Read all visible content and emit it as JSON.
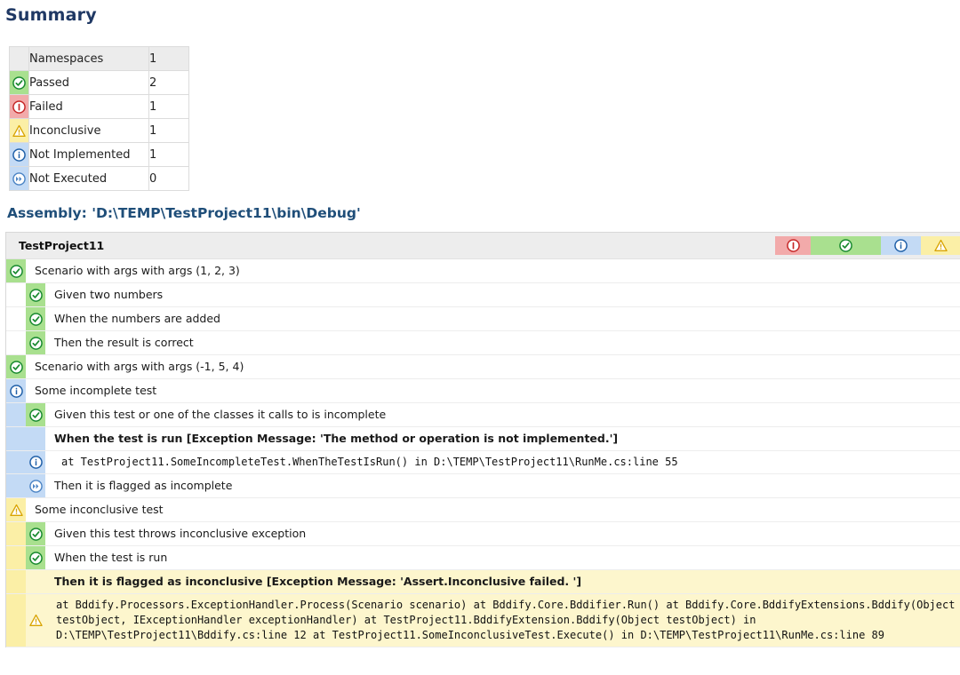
{
  "summary": {
    "title": "Summary",
    "rows": [
      {
        "label": "Namespaces",
        "value": "1",
        "icon": "none",
        "tone": "namespaces"
      },
      {
        "label": "Passed",
        "value": "2",
        "icon": "check-circle-icon",
        "tone": "pass"
      },
      {
        "label": "Failed",
        "value": "1",
        "icon": "error-circle-icon",
        "tone": "fail"
      },
      {
        "label": "Inconclusive",
        "value": "1",
        "icon": "warning-triangle-icon",
        "tone": "incon"
      },
      {
        "label": "Not Implemented",
        "value": "1",
        "icon": "info-circle-icon",
        "tone": "notimpl"
      },
      {
        "label": "Not Executed",
        "value": "0",
        "icon": "skip-circle-icon",
        "tone": "notexec"
      }
    ]
  },
  "assembly": {
    "title": "Assembly: 'D:\\TEMP\\TestProject11\\bin\\Debug'",
    "project_name": "TestProject11",
    "filters": [
      {
        "name": "filter-failed",
        "icon": "error-circle-icon"
      },
      {
        "name": "filter-passed",
        "icon": "check-circle-icon"
      },
      {
        "name": "filter-not-implemented",
        "icon": "info-circle-icon"
      },
      {
        "name": "filter-inconclusive",
        "icon": "warning-triangle-icon"
      }
    ]
  },
  "tests": [
    {
      "text": "Scenario with args with args (1, 2, 3)",
      "icon": "check-circle-icon",
      "tone": "pass",
      "level": 0,
      "style": "normal"
    },
    {
      "text": "Given two numbers",
      "icon": "check-circle-icon",
      "tone": "pass",
      "level": 1,
      "style": "normal"
    },
    {
      "text": "When the numbers are added",
      "icon": "check-circle-icon",
      "tone": "pass",
      "level": 1,
      "style": "normal"
    },
    {
      "text": "Then the result is correct",
      "icon": "check-circle-icon",
      "tone": "pass",
      "level": 1,
      "style": "normal"
    },
    {
      "text": "Scenario with args with args (-1, 5, 4)",
      "icon": "check-circle-icon",
      "tone": "pass",
      "level": 0,
      "style": "normal"
    },
    {
      "text": "Some incomplete test",
      "icon": "info-circle-icon",
      "tone": "notimpl",
      "level": 0,
      "style": "normal"
    },
    {
      "text": "Given this test or one of the classes it calls to is incomplete",
      "icon": "check-circle-icon",
      "tone": "pass",
      "level": 1,
      "style": "normal"
    },
    {
      "text": "When the test is run [Exception Message: 'The method or operation is not implemented.']",
      "icon": "none",
      "tone": "notimpl",
      "level": 1,
      "style": "bold"
    },
    {
      "text": "at TestProject11.SomeIncompleteTest.WhenTheTestIsRun() in D:\\TEMP\\TestProject11\\RunMe.cs:line 55",
      "icon": "info-circle-icon",
      "tone": "notimpl",
      "level": 1,
      "style": "mono"
    },
    {
      "text": "Then it is flagged as incomplete",
      "icon": "skip-circle-icon",
      "tone": "notexec",
      "level": 1,
      "style": "normal"
    },
    {
      "text": "Some inconclusive test",
      "icon": "warning-triangle-icon",
      "tone": "incon",
      "level": 0,
      "style": "normal"
    },
    {
      "text": "Given this test throws inconclusive exception",
      "icon": "check-circle-icon",
      "tone": "pass",
      "level": 1,
      "style": "normal"
    },
    {
      "text": "When the test is run",
      "icon": "check-circle-icon",
      "tone": "pass",
      "level": 1,
      "style": "normal"
    },
    {
      "text": "Then it is flagged as inconclusive [Exception Message: 'Assert.Inconclusive failed. ']",
      "icon": "none",
      "tone": "incon",
      "level": 1,
      "style": "bold"
    },
    {
      "text": "at Bddify.Processors.ExceptionHandler.Process(Scenario scenario) at Bddify.Core.Bddifier.Run() at Bddify.Core.BddifyExtensions.Bddify(Object testObject, IExceptionHandler exceptionHandler) at TestProject11.BddifyExtension.Bddify(Object testObject) in D:\\TEMP\\TestProject11\\Bddify.cs:line 12 at TestProject11.SomeInconclusiveTest.Execute() in D:\\TEMP\\TestProject11\\RunMe.cs:line 89",
      "icon": "warning-triangle-icon",
      "tone": "incon",
      "level": 1,
      "style": "trace"
    }
  ],
  "colors": {
    "pass": "#a9e08f",
    "fail": "#f2aaaa",
    "inconclusive": "#fbefa6",
    "not_implemented": "#c3daf5",
    "not_executed": "#c3daf5",
    "heading": "#1f3864",
    "assembly_heading": "#1f4e79"
  }
}
